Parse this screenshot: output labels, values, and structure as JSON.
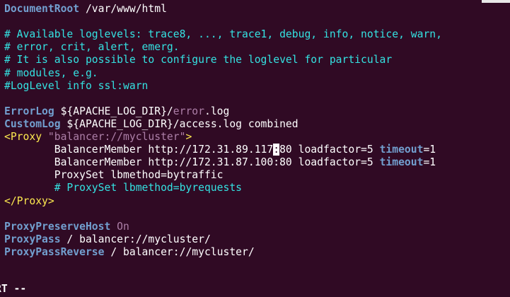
{
  "editor": {
    "status_text": "RT --",
    "colors": {
      "background": "#300a24",
      "directive": "#729fcf",
      "comment": "#34e2e2",
      "string": "#ad7fa8",
      "tag": "#fce94f",
      "text": "#ffffff"
    },
    "lines": [
      [
        {
          "t": "DocumentRoot",
          "c": "dir"
        },
        {
          "t": " /var/www/html",
          "c": "txt"
        }
      ],
      [],
      [
        {
          "t": "# Available loglevels: trace8, ..., trace1, debug, info, notice, warn,",
          "c": "cmt"
        }
      ],
      [
        {
          "t": "# error, crit, alert, emerg.",
          "c": "cmt"
        }
      ],
      [
        {
          "t": "# It is also possible to configure the loglevel for particular",
          "c": "cmt"
        }
      ],
      [
        {
          "t": "# modules, e.g.",
          "c": "cmt"
        }
      ],
      [
        {
          "t": "#LogLevel info ssl:warn",
          "c": "cmt"
        }
      ],
      [],
      [
        {
          "t": "ErrorLog",
          "c": "dir"
        },
        {
          "t": " ${APACHE_LOG_DIR}/",
          "c": "txt"
        },
        {
          "t": "error",
          "c": "str"
        },
        {
          "t": ".log",
          "c": "txt"
        }
      ],
      [
        {
          "t": "CustomLog",
          "c": "dir"
        },
        {
          "t": " ${APACHE_LOG_DIR}/access.log combined",
          "c": "txt"
        }
      ],
      [
        {
          "t": "<Proxy",
          "c": "tag"
        },
        {
          "t": " \"balancer://mycluster\"",
          "c": "str"
        },
        {
          "t": ">",
          "c": "tag"
        }
      ],
      [
        {
          "t": "        BalancerMember http://172.31.89.117",
          "c": "txt"
        },
        {
          "t": ":",
          "c": "cursor"
        },
        {
          "t": "80 loadfactor=5 ",
          "c": "txt"
        },
        {
          "t": "timeout",
          "c": "dir"
        },
        {
          "t": "=1",
          "c": "txt"
        }
      ],
      [
        {
          "t": "        BalancerMember http://172.31.87.100:80 loadfactor=5 ",
          "c": "txt"
        },
        {
          "t": "timeout",
          "c": "dir"
        },
        {
          "t": "=1",
          "c": "txt"
        }
      ],
      [
        {
          "t": "        ProxySet lbmethod=bytraffic",
          "c": "txt"
        }
      ],
      [
        {
          "t": "        # ProxySet lbmethod=byrequests",
          "c": "cmt"
        }
      ],
      [
        {
          "t": "</Proxy>",
          "c": "tag"
        }
      ],
      [],
      [
        {
          "t": "ProxyPreserveHost",
          "c": "dir"
        },
        {
          "t": " ",
          "c": "txt"
        },
        {
          "t": "On",
          "c": "str"
        }
      ],
      [
        {
          "t": "ProxyPass",
          "c": "dir"
        },
        {
          "t": " / balancer://mycluster/",
          "c": "txt"
        }
      ],
      [
        {
          "t": "ProxyPassReverse",
          "c": "dir"
        },
        {
          "t": " / balancer://mycluster/",
          "c": "txt"
        }
      ]
    ]
  }
}
